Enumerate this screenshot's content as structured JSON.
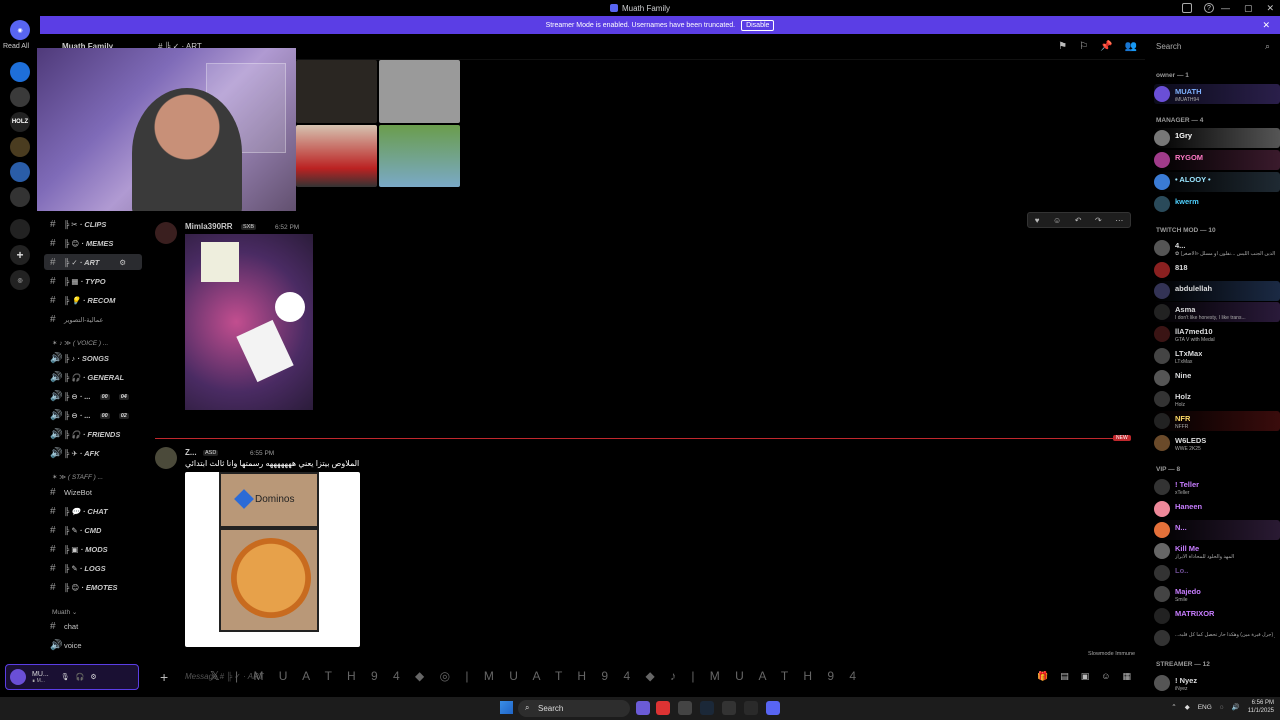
{
  "window": {
    "title": "Muath Family",
    "min": "—",
    "max": "▢",
    "close": "✕"
  },
  "banner": {
    "text": "Streamer Mode is enabled. Usernames have been truncated.",
    "button": "Disable",
    "close": "✕"
  },
  "rail": {
    "read_all": "Read All",
    "server_holz": "HOLZ"
  },
  "header": {
    "server_name": "Muath Family",
    "channel_name": "# ╠ ✓ · ART",
    "search_placeholder": "Search"
  },
  "channels": [
    {
      "label": "╠ ✂ · CLIPS"
    },
    {
      "label": "╠ 😊 · MEMES"
    },
    {
      "label": "╠ ✓ · ART"
    },
    {
      "label": "╠ ▦ · TYPO"
    },
    {
      "label": "╠ 💡 · RECOM"
    },
    {
      "label": "عمالية-التصوير"
    }
  ],
  "voice_category": "✶ ♪ ≫ ( VOICE ) ...",
  "voice_channels": [
    {
      "label": "╠ ♪ · SONGS"
    },
    {
      "label": "╠ 🎧 · GENERAL"
    },
    {
      "label": "╠ ⊖ · ...",
      "count_a": "00",
      "count_b": "04"
    },
    {
      "label": "╠ ⊖ · ...",
      "count_a": "00",
      "count_b": "02"
    },
    {
      "label": "╠ 🎧 · FRIENDS"
    },
    {
      "label": "╠ ✈ · AFK"
    }
  ],
  "staff_category": "✶ ≫ ( STAFF ) ...",
  "staff_channels": [
    {
      "label": "WizeBot"
    },
    {
      "label": "╠ 💬 · CHAT"
    },
    {
      "label": "╠ ✎ · CMD"
    },
    {
      "label": "╠ ▣ · MODS"
    },
    {
      "label": "╠ ✎ · LOGS"
    },
    {
      "label": "╠ 😊 · EMOTES"
    }
  ],
  "muath_category": "Muath ⌄",
  "muath_channels": [
    {
      "label": "chat"
    },
    {
      "label": "voice"
    }
  ],
  "user_panel": {
    "name": "MU...",
    "status": "∎ M..."
  },
  "messages": [
    {
      "user": "Mimla390RR",
      "badge": "SXB",
      "time": "6:52 PM"
    },
    {
      "user": "Z...",
      "badge": "ASD",
      "time": "6:55 PM",
      "text": "الملاوص بيتزا يعني هههههههه رسمتها وانا ثالث ابتدائي"
    }
  ],
  "reactions": [
    {
      "emoji": "💜",
      "count": "1"
    },
    {
      "emoji": "💔",
      "count": "1"
    },
    {
      "emoji": "🔨",
      "count": "1"
    }
  ],
  "new_tag": "NEW",
  "pizza_brand": "Dominos",
  "composer": {
    "placeholder": "Message # ╠ ✓ · ART",
    "ticker": "𝕏 | M U A T H 9 4 ◆ ◎ | M U A T H 9 4 ◆ ♪ | M U A T H 9 4"
  },
  "slowmode": "Slowmode Immune",
  "member_groups": {
    "owner": "owner — 1",
    "manager": "MANAGER — 4",
    "twitch_mod": "TWITCH MOD — 10",
    "vip": "VIP — 8",
    "streamer": "STREAMER — 12"
  },
  "members_owner": [
    {
      "name": "MUATH",
      "tag": "NJM",
      "status": "iMUATH94",
      "color": "#7fb2ff"
    }
  ],
  "members_manager": [
    {
      "name": "1Gry",
      "tag": "",
      "status": "",
      "color": "#ffffff"
    },
    {
      "name": "RYGOM",
      "tag": "GOLD",
      "status": "",
      "color": "#ff79c6"
    },
    {
      "name": "• ALOOY •",
      "tag": "NJM",
      "status": "",
      "color": "#9be6ff"
    },
    {
      "name": "kwerm",
      "tag": "SPA",
      "status": "",
      "color": "#4fd1ff"
    }
  ],
  "members_twitch": [
    {
      "name": "4...",
      "status": "✿ (والوالدين الجنب الليس ...نفلون او مسلل «الأصغر",
      "color": "#ffffff"
    },
    {
      "name": "818",
      "status": "",
      "color": "#ffffff"
    },
    {
      "name": "abdulellah",
      "status": "",
      "color": "#ffffff"
    },
    {
      "name": "Asma",
      "status": "I don't like honesty, I like trans...",
      "color": "#ffffff"
    },
    {
      "name": "llA7med10",
      "status": "GTA V with Medal",
      "color": "#ffffff"
    },
    {
      "name": "LTxMax",
      "tag": "90",
      "status": "LTxMax",
      "color": "#ffffff"
    },
    {
      "name": "Nine",
      "status": "",
      "color": "#ffffff"
    },
    {
      "name": "Holz",
      "tag": "BRQ",
      "status": "Holz",
      "color": "#ffffff"
    },
    {
      "name": "NFR",
      "tag": "GOLD",
      "status": "NFFR",
      "color": "#ffd966"
    },
    {
      "name": "W6LEDS",
      "status": "WWE 2K25",
      "color": "#ffffff"
    }
  ],
  "members_vip": [
    {
      "name": "! Teller",
      "tag": "GOAT",
      "status": "xTeller",
      "color": "#c77dff"
    },
    {
      "name": "Haneen",
      "status": "",
      "color": "#c77dff"
    },
    {
      "name": "N...",
      "tag": "GLXY",
      "status": "",
      "color": "#c77dff"
    },
    {
      "name": "Kill Me",
      "status": "المهد والحلود للمحاذاة الأبراز",
      "color": "#c77dff"
    },
    {
      "name": "Lo..",
      "status": "",
      "color": "#6a4b8f"
    },
    {
      "name": "Majedo",
      "status": "Smile",
      "color": "#c77dff"
    },
    {
      "name": "MATRIXOR",
      "tag": "STAR",
      "status": "",
      "color": "#c77dff"
    },
    {
      "name": "",
      "status": "...يل لك و (جرل فيرة مين) وهكذا حار تحصل كما كل قلبه",
      "color": "#c77dff"
    }
  ],
  "members_streamer": [
    {
      "name": "! Nyez",
      "tag": "Lazy",
      "status": "iNyez",
      "color": "#ffffff"
    }
  ],
  "taskbar": {
    "search": "Search",
    "lang": "ENG",
    "time": "6:56 PM",
    "date": "11/1/2025"
  },
  "colors": {
    "accent": "#5b3ee5",
    "new_line": "#c0282d"
  }
}
